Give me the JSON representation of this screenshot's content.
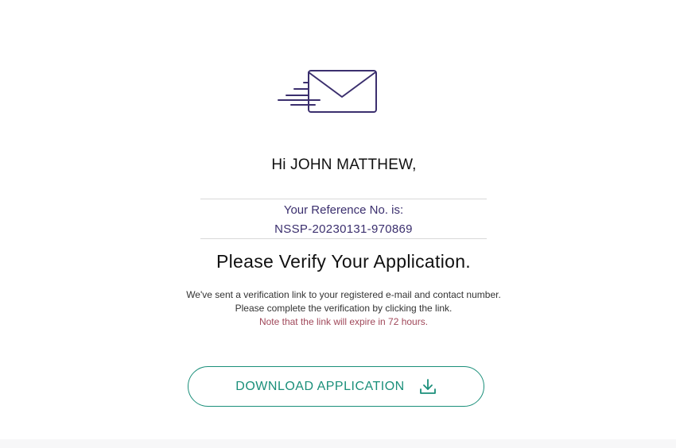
{
  "icons": {
    "envelope": "envelope-sent-icon",
    "download": "download-icon"
  },
  "colors": {
    "brand_purple": "#3b2f6e",
    "accent_teal": "#1a8f7a",
    "note_red": "#a0485a"
  },
  "greeting": "Hi JOHN MATTHEW,",
  "reference": {
    "label": "Your Reference No. is:",
    "number": "NSSP-20230131-970869"
  },
  "headline": "Please Verify Your Application.",
  "message": {
    "line1": "We've sent a verification link to your registered e-mail and contact number.",
    "line2": "Please complete the verification by clicking the link.",
    "note": "Note that the link will expire in 72 hours."
  },
  "download_button": {
    "label": "DOWNLOAD APPLICATION"
  }
}
